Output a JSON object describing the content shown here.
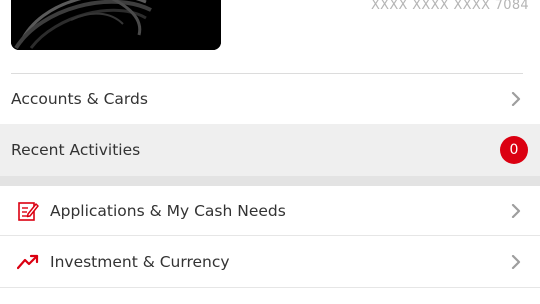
{
  "card": {
    "masked_number": "XXXX XXXX XXXX 7084"
  },
  "menu": {
    "accounts_label": "Accounts & Cards",
    "recent_label": "Recent Activities",
    "recent_badge": "0",
    "applications_label": "Applications & My Cash Needs",
    "investment_label": "Investment & Currency"
  },
  "icons": {
    "applications": "edit-document-icon",
    "investment": "trending-up-icon",
    "chevron": "chevron-right-icon"
  },
  "colors": {
    "accent": "#db0011",
    "chevron": "#9e9e9e",
    "selected_row": "#efefef"
  }
}
